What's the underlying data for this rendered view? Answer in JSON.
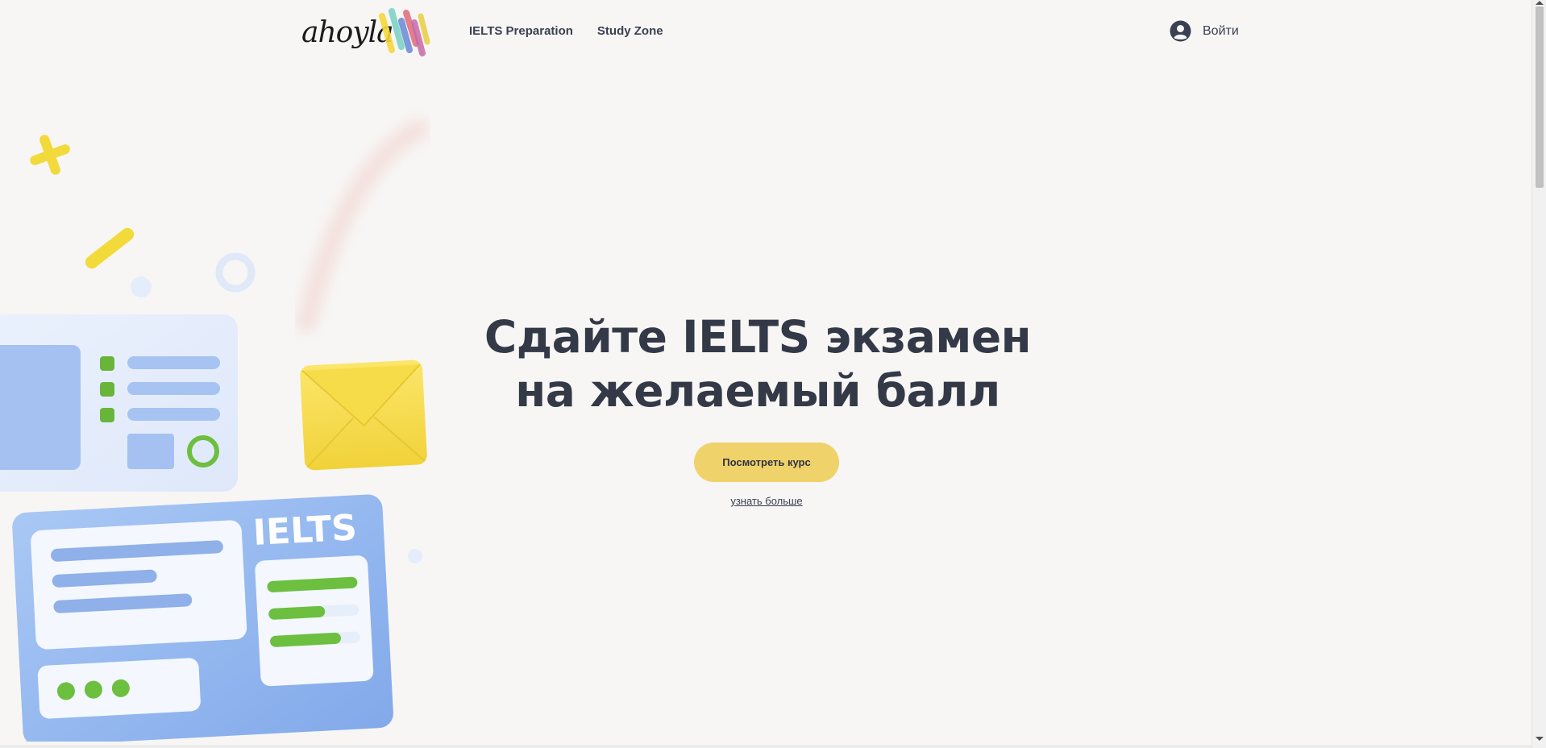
{
  "header": {
    "logo_text": "ahoyla",
    "nav": [
      {
        "label": "IELTS Preparation"
      },
      {
        "label": "Study Zone"
      }
    ],
    "login_label": "Войти"
  },
  "hero": {
    "title_line1": "Сдайте IELTS экзамен",
    "title_line2": "на желаемый балл",
    "cta_label": "Посмотреть курс",
    "more_link": "узнать больше"
  },
  "illustration": {
    "badge_text": "IELTS"
  },
  "colors": {
    "background": "#f7f6f4",
    "text": "#333947",
    "cta": "#f0d26a",
    "accent_blue": "#8fb4ee",
    "accent_green": "#6cbf3f",
    "accent_yellow": "#f5d83a"
  },
  "icons": {
    "login": "user-circle-icon",
    "envelope": "envelope-icon",
    "cross": "cross-icon",
    "ring": "ring-icon"
  }
}
